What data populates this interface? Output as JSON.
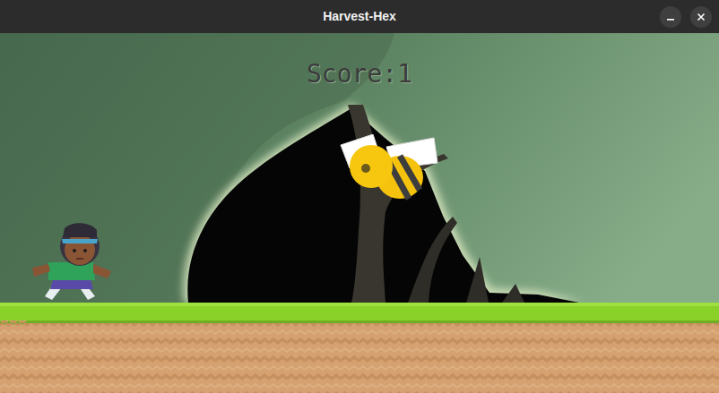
{
  "window": {
    "title": "Harvest-Hex"
  },
  "hud": {
    "score": "Score:1"
  }
}
